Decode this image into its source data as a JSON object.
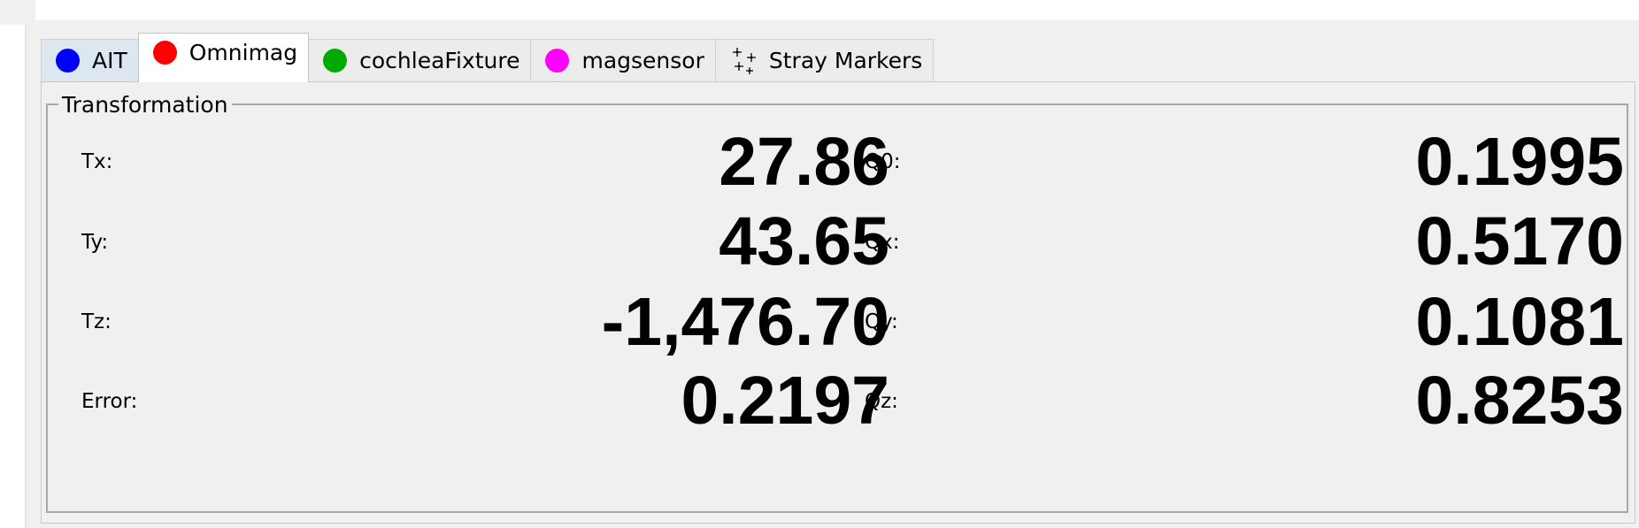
{
  "tabs": [
    {
      "label": "AIT",
      "color": "#0000ff",
      "icon": "blue-dot-icon"
    },
    {
      "label": "Omnimag",
      "color": "#ff0000",
      "icon": "red-dot-icon",
      "active": true
    },
    {
      "label": "cochleaFixture",
      "color": "#00aa00",
      "icon": "green-dot-icon"
    },
    {
      "label": "magsensor",
      "color": "#ff00ff",
      "icon": "magenta-dot-icon"
    },
    {
      "label": "Stray Markers",
      "icon": "stray-markers-icon"
    }
  ],
  "transformation": {
    "title": "Transformation",
    "tx_label": "Tx:",
    "tx_value": "27.86",
    "ty_label": "Ty:",
    "ty_value": "43.65",
    "tz_label": "Tz:",
    "tz_value": "-1,476.70",
    "error_label": "Error:",
    "error_value": "0.2197",
    "q0_label": "Q0:",
    "q0_value": "0.1995",
    "qx_label": "Qx:",
    "qx_value": "0.5170",
    "qy_label": "Qy:",
    "qy_value": "0.1081",
    "qz_label": "Qz:",
    "qz_value": "0.8253"
  }
}
